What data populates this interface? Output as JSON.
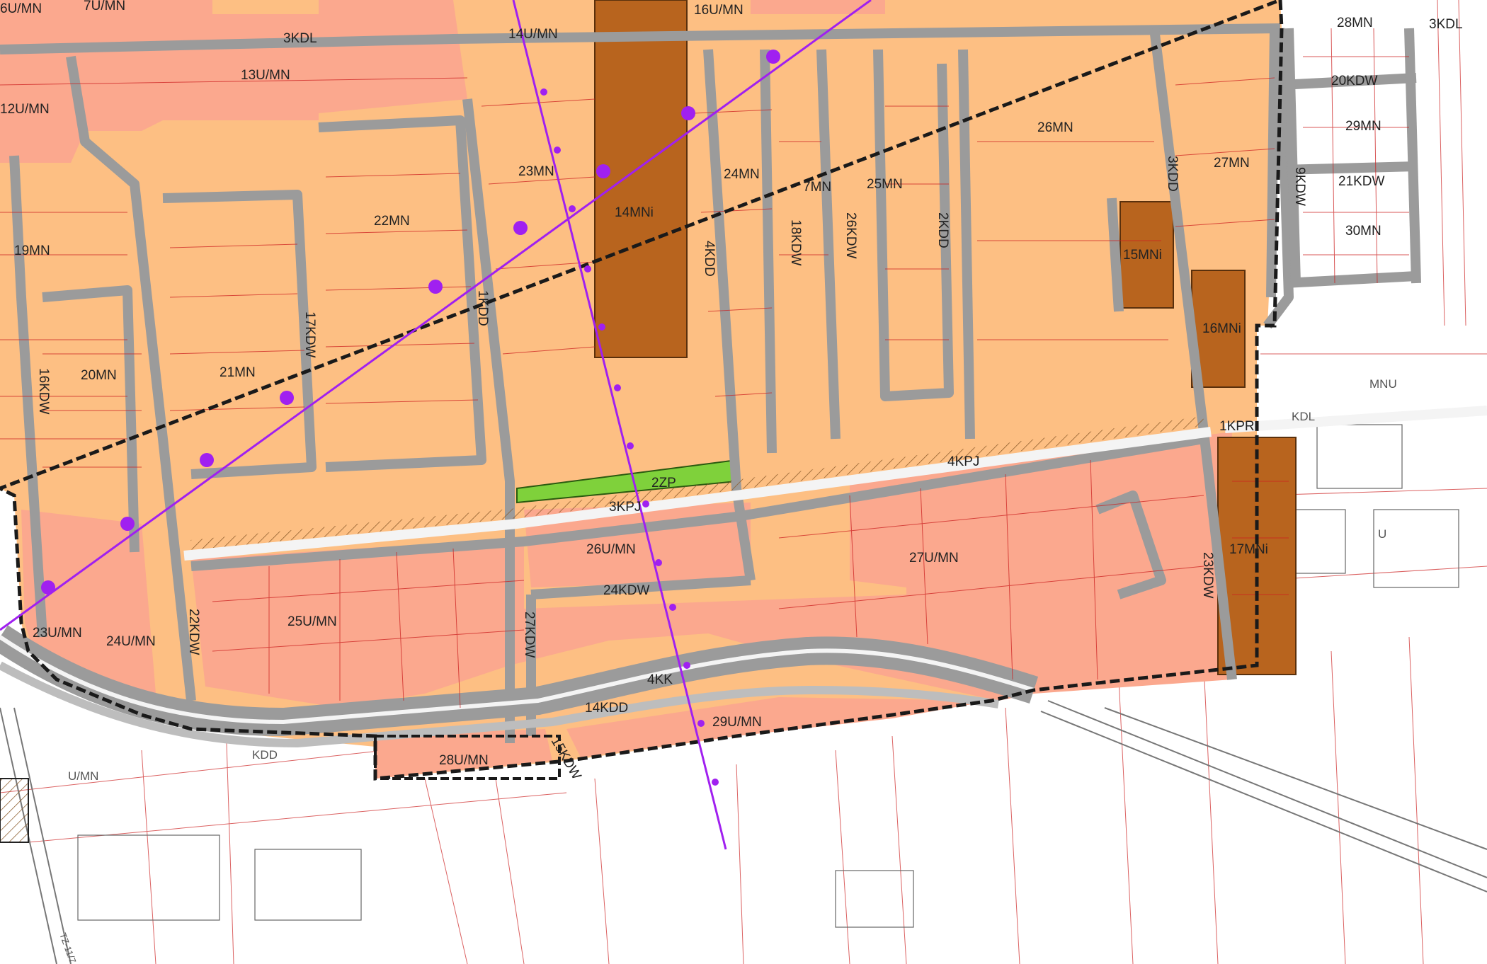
{
  "colors": {
    "mn": "#fdbf83",
    "umn": "#fba88e",
    "mni": "#b8641e",
    "zp": "#7fd13b",
    "road": "#9b9b9b",
    "boundary": "#1a1a1a",
    "power_line": "#a020f0",
    "parcel_line": "#cc2020"
  },
  "labels": {
    "u_mn_tl": "6U/MN",
    "u7": "7U/MN",
    "kdl3_top": "3KDL",
    "u16": "16U/MN",
    "u14": "14U/MN",
    "mn28": "28MN",
    "kdl3_right": "3KDL",
    "u13": "13U/MN",
    "u12": "12U/MN",
    "kdw20": "20KDW",
    "mn29": "29MN",
    "kdw21": "21KDW",
    "mn30": "30MN",
    "mn26": "26MN",
    "mn27": "27MN",
    "kdw9": "9KDW",
    "kdd3": "3KDD",
    "mn22": "22MN",
    "mn23": "23MN",
    "mni14": "14MNi",
    "mn24": "24MN",
    "mn7": "7MN",
    "mn25": "25MN",
    "kdw18": "18KDW",
    "kdw26": "26KDW",
    "kdd2": "2KDD",
    "mni15": "15MNi",
    "mn19": "19MN",
    "mni16": "16MNi",
    "mnu": "MNU",
    "mn20": "20MN",
    "mn21": "21MN",
    "kdw16": "16KDW",
    "kdw17": "17KDW",
    "kdd1": "1KDD",
    "kdd4": "4KDD",
    "kdl_right": "KDL",
    "kpr1": "1KPR",
    "kpj4": "4KPJ",
    "zp2": "2ZP",
    "kpj3": "3KPJ",
    "umn26": "26U/MN",
    "umn27": "27U/MN",
    "mni17": "17MNi",
    "kdw23": "23KDW",
    "kdw24": "24KDW",
    "umn25": "25U/MN",
    "kdw27": "27KDW",
    "kdw22": "22KDW",
    "umn23": "23U/MN",
    "umn24": "24U/MN",
    "kk4": "4KK",
    "kdd14": "14KDD",
    "umn29": "29U/MN",
    "kdd": "KDD",
    "umn28": "28U/MN",
    "kdw15": "15KDW",
    "umn_out": "U/MN",
    "u_right": "U",
    "tz": "TZ-11/7 A"
  }
}
